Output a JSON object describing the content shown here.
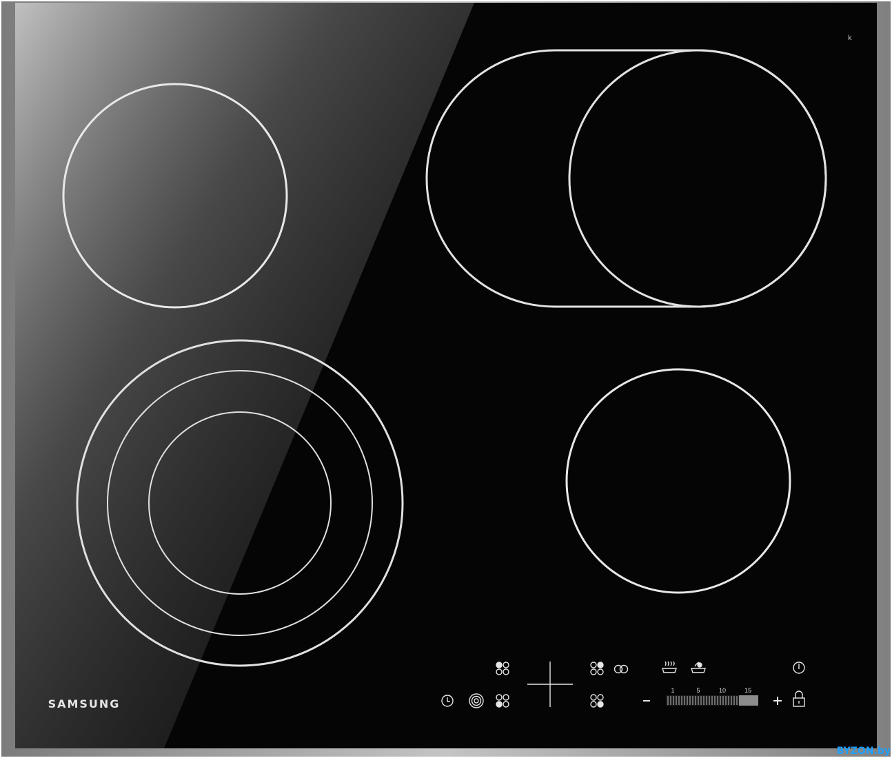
{
  "brand": "SAMSUNG",
  "watermark": "BYZON.by",
  "corner_mark": "k",
  "timer_scale": {
    "ticks": [
      "1",
      "5",
      "10",
      "15"
    ]
  },
  "controls": {
    "minus_symbol": "−",
    "plus_symbol": "+"
  },
  "colors": {
    "glass": "#050505",
    "frame": "#9a9a9a",
    "zone_outline": "#e8e8e8",
    "watermark": "#1da1ff"
  },
  "icons": [
    "zone-select-icon",
    "crosshair-icon",
    "dual-zone-icon",
    "keep-warm-icon",
    "boil-icon",
    "power-icon",
    "timer-icon",
    "triple-ring-icon",
    "lock-icon"
  ]
}
